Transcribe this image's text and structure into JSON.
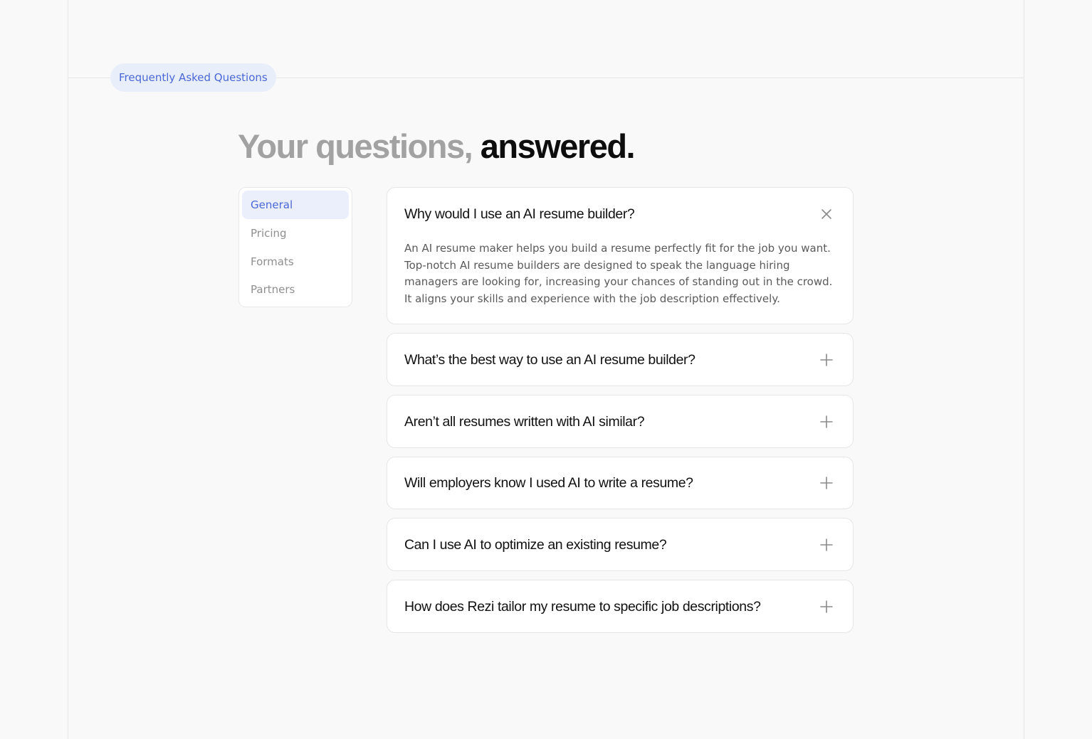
{
  "section": {
    "eyebrow": "Frequently Asked Questions",
    "heading_muted": "Your questions,",
    "heading_strong": "answered."
  },
  "nav": {
    "items": [
      {
        "label": "General",
        "active": true
      },
      {
        "label": "Pricing",
        "active": false
      },
      {
        "label": "Formats",
        "active": false
      },
      {
        "label": "Partners",
        "active": false
      }
    ]
  },
  "faqs": [
    {
      "question": "Why would I use an AI resume builder?",
      "expanded": true,
      "icon": "close-icon",
      "answer": "An AI resume maker helps you build a resume perfectly fit for the job you want. Top-notch AI resume builders are designed to speak the language hiring managers are looking for, increasing your chances of standing out in the crowd. It aligns your skills and experience with the job description effectively."
    },
    {
      "question": "What’s the best way to use an AI resume builder?",
      "expanded": false,
      "icon": "plus-icon"
    },
    {
      "question": "Aren’t all resumes written with AI similar?",
      "expanded": false,
      "icon": "plus-icon"
    },
    {
      "question": "Will employers know I used AI to write a resume?",
      "expanded": false,
      "icon": "plus-icon"
    },
    {
      "question": "Can I use AI to optimize an existing resume?",
      "expanded": false,
      "icon": "plus-icon"
    },
    {
      "question": "How does Rezi tailor my resume to specific job descriptions?",
      "expanded": false,
      "icon": "plus-icon"
    }
  ],
  "colors": {
    "accent": "#4a68d6",
    "accent_bg": "#e9eefb",
    "page_bg": "#f9f9f9",
    "muted_heading": "#a2a2a2",
    "icon": "#8a8a8a"
  }
}
